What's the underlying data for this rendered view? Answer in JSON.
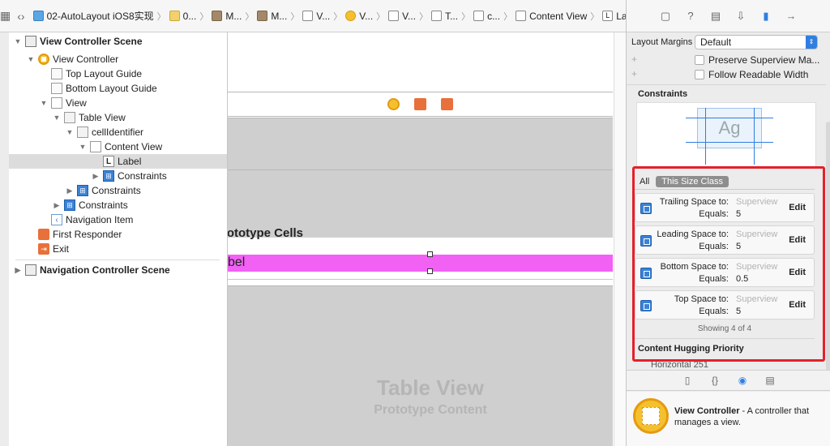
{
  "jumpbar": {
    "crumbs": [
      {
        "icon": "project-icon",
        "label": "02-AutoLayout iOS8实现"
      },
      {
        "icon": "folder-icon",
        "label": "0..."
      },
      {
        "icon": "storyboard-icon",
        "label": "M..."
      },
      {
        "icon": "storyboard-icon",
        "label": "M..."
      },
      {
        "icon": "scene-icon",
        "label": "V..."
      },
      {
        "icon": "view-controller-icon",
        "label": "V..."
      },
      {
        "icon": "view-icon",
        "label": "V..."
      },
      {
        "icon": "table-view-icon",
        "label": "T..."
      },
      {
        "icon": "cell-icon",
        "label": "c..."
      },
      {
        "icon": "view-icon",
        "label": "Content View"
      },
      {
        "icon": "label-icon",
        "label": "Label"
      }
    ]
  },
  "outline": {
    "items": [
      {
        "label": "View Controller Scene",
        "indent": 0,
        "tri": "down",
        "icon": "scene",
        "scene": true
      },
      {
        "label": "View Controller",
        "indent": 1,
        "tri": "down",
        "icon": "vc"
      },
      {
        "label": "Top Layout Guide",
        "indent": 2,
        "tri": "",
        "icon": "guide"
      },
      {
        "label": "Bottom Layout Guide",
        "indent": 2,
        "tri": "",
        "icon": "guide"
      },
      {
        "label": "View",
        "indent": 2,
        "tri": "down",
        "icon": "plain"
      },
      {
        "label": "Table View",
        "indent": 3,
        "tri": "down",
        "icon": "table"
      },
      {
        "label": "cellIdentifier",
        "indent": 4,
        "tri": "down",
        "icon": "table"
      },
      {
        "label": "Content View",
        "indent": 5,
        "tri": "down",
        "icon": "plain"
      },
      {
        "label": "Label",
        "indent": 6,
        "tri": "",
        "icon": "lbl",
        "selected": true
      },
      {
        "label": "Constraints",
        "indent": 6,
        "tri": "right",
        "icon": "cons"
      },
      {
        "label": "Constraints",
        "indent": 4,
        "tri": "right",
        "icon": "cons"
      },
      {
        "label": "Constraints",
        "indent": 3,
        "tri": "right",
        "icon": "cons"
      },
      {
        "label": "Navigation Item",
        "indent": 2,
        "tri": "",
        "icon": "nav"
      },
      {
        "label": "First Responder",
        "indent": 1,
        "tri": "",
        "icon": "fr"
      },
      {
        "label": "Exit",
        "indent": 1,
        "tri": "",
        "icon": "exit"
      },
      {
        "label": "Navigation Controller Scene",
        "indent": 0,
        "tri": "right",
        "icon": "scene",
        "scene": true
      }
    ]
  },
  "canvas": {
    "prototype_cells_title": "rototype Cells",
    "label_text": "bel",
    "table_view_title": "Table View",
    "table_view_subtitle": "Prototype Content"
  },
  "inspector": {
    "layout_margins_label": "Layout Margins",
    "layout_margins_value": "Default",
    "preserve_superview": "Preserve Superview Ma...",
    "follow_readable": "Follow Readable Width",
    "constraints_header": "Constraints",
    "preview_text": "Ag",
    "seg_all": "All",
    "seg_size_class": "This Size Class",
    "constraints": [
      {
        "name": "Trailing Space to:",
        "target": "Superview",
        "equals_label": "Equals:",
        "value": "5",
        "edit": "Edit"
      },
      {
        "name": "Leading Space to:",
        "target": "Superview",
        "equals_label": "Equals:",
        "value": "5",
        "edit": "Edit"
      },
      {
        "name": "Bottom Space to:",
        "target": "Superview",
        "equals_label": "Equals:",
        "value": "0.5",
        "edit": "Edit"
      },
      {
        "name": "Top Space to:",
        "target": "Superview",
        "equals_label": "Equals:",
        "value": "5",
        "edit": "Edit"
      }
    ],
    "showing": "Showing 4 of 4",
    "hugging_header": "Content Hugging Priority",
    "hugging_horizontal": "Horizontal 251"
  },
  "library": {
    "title": "View Controller",
    "description": " - A controller that manages a view."
  },
  "colors": {
    "highlight_red": "#e5202a",
    "accent_blue": "#2f7fe0",
    "label_pink": "#f061f4"
  }
}
